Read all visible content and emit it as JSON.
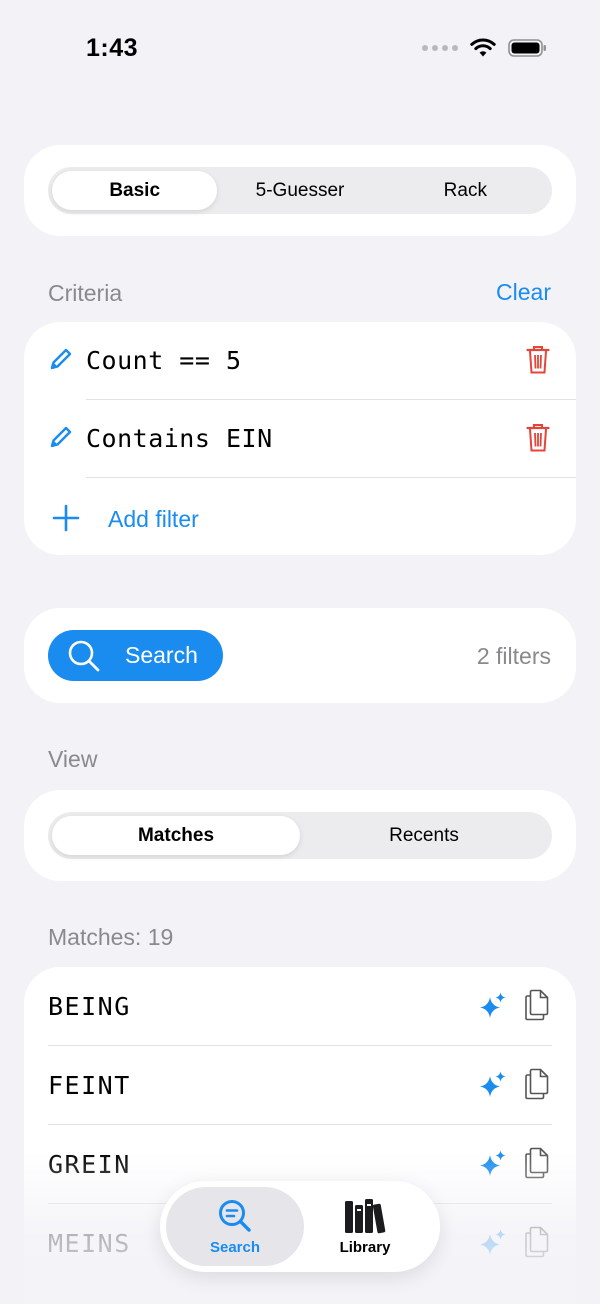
{
  "status_bar": {
    "time": "1:43"
  },
  "mode_tabs": [
    "Basic",
    "5-Guesser",
    "Rack"
  ],
  "mode_selected": "Basic",
  "criteria": {
    "label": "Criteria",
    "clear_label": "Clear",
    "filters": [
      "Count == 5",
      "Contains EIN"
    ],
    "add_label": "Add filter"
  },
  "search": {
    "button_label": "Search",
    "filter_count": "2 filters"
  },
  "view": {
    "label": "View",
    "tabs": [
      "Matches",
      "Recents"
    ],
    "selected": "Matches"
  },
  "matches": {
    "label": "Matches: 19",
    "words": [
      "BEING",
      "FEINT",
      "GREIN",
      "MEINS"
    ]
  },
  "tabbar": {
    "items": [
      "Search",
      "Library"
    ],
    "selected": "Search"
  },
  "colors": {
    "accent": "#1a8cf0",
    "delete": "#e5443a",
    "background": "#f2f2f7"
  },
  "icons": {
    "edit": "pencil-icon",
    "delete": "trash-icon",
    "add": "plus-icon",
    "search": "magnifier-icon",
    "suggest": "sparkle-icon",
    "copy": "copy-icon",
    "library": "books-icon"
  }
}
